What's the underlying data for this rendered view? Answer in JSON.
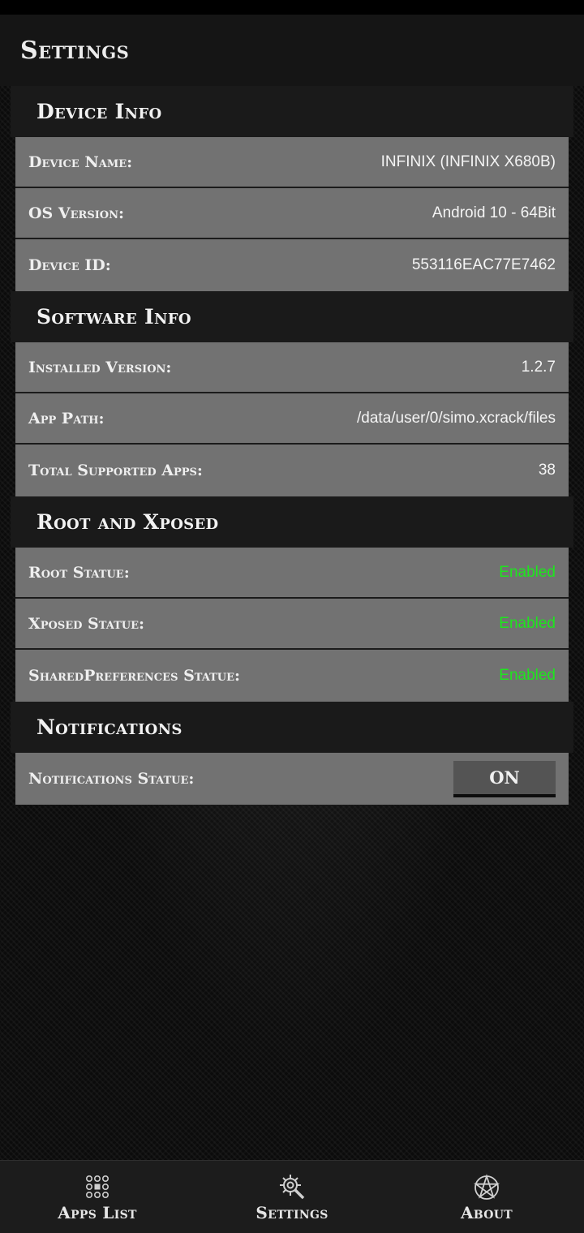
{
  "header": {
    "title": "Settings"
  },
  "sections": [
    {
      "title": "Device Info",
      "rows": [
        {
          "label": "Device Name:",
          "value": "INFINIX (INFINIX X680B)"
        },
        {
          "label": "OS Version:",
          "value": "Android 10 - 64Bit"
        },
        {
          "label": "Device ID:",
          "value": "553116EAC77E7462"
        }
      ]
    },
    {
      "title": "Software Info",
      "rows": [
        {
          "label": "Installed Version:",
          "value": "1.2.7"
        },
        {
          "label": "App Path:",
          "value": "/data/user/0/simo.xcrack/files"
        },
        {
          "label": "Total Supported Apps:",
          "value": "38"
        }
      ]
    },
    {
      "title": "Root and Xposed",
      "rows": [
        {
          "label": "Root Statue:",
          "value": "Enabled"
        },
        {
          "label": "Xposed Statue:",
          "value": "Enabled"
        },
        {
          "label": "SharedPreferences Statue:",
          "value": "Enabled"
        }
      ]
    },
    {
      "title": "Notifications",
      "rows": [
        {
          "label": "Notifications Statue:",
          "button": "ON"
        }
      ]
    }
  ],
  "status_colors": {
    "enabled": "#1ee51e"
  },
  "bottom_nav": [
    {
      "label": "Apps List",
      "icon": "apps-grid-icon"
    },
    {
      "label": "Settings",
      "icon": "gear-wrench-icon"
    },
    {
      "label": "About",
      "icon": "pentagram-icon"
    }
  ]
}
